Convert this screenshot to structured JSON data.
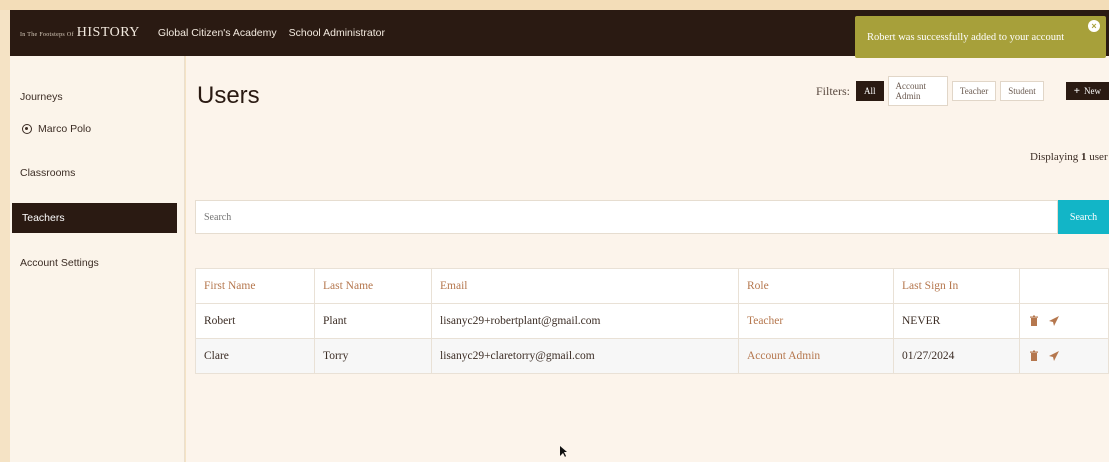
{
  "navbar": {
    "logo_small": "In The Footsteps Of",
    "logo_big": "HISTORY",
    "links": [
      "Global Citizen's Academy",
      "School Administrator"
    ]
  },
  "sidebar": {
    "journeys": "Journeys",
    "journey_sub": "Marco Polo",
    "classrooms": "Classrooms",
    "teachers": "Teachers",
    "account_settings": "Account Settings"
  },
  "page": {
    "title": "Users",
    "filters_label": "Filters:",
    "filters": [
      "All",
      "Account Admin",
      "Teacher",
      "Student"
    ],
    "new_label": "New",
    "displaying_prefix": "Displaying",
    "displaying_count": "1",
    "displaying_suffix": "user"
  },
  "search": {
    "placeholder": "Search",
    "button_label": "Search"
  },
  "table": {
    "headers": [
      "First Name",
      "Last Name",
      "Email",
      "Role",
      "Last Sign In"
    ],
    "rows": [
      {
        "first": "Robert",
        "last": "Plant",
        "email": "lisanyc29+robertplant@gmail.com",
        "role": "Teacher",
        "last_sign_in": "NEVER"
      },
      {
        "first": "Clare",
        "last": "Torry",
        "email": "lisanyc29+claretorry@gmail.com",
        "role": "Account Admin",
        "last_sign_in": "01/27/2024"
      }
    ]
  },
  "toast": {
    "message": "Robert was successfully added to your account",
    "close": "×"
  },
  "colors": {
    "navbar_bg": "#2a1a12",
    "accent_brown": "#b5774e",
    "search_button": "#12b5c7",
    "toast_bg": "#a7a03a"
  },
  "icons": [
    "compass-icon",
    "plus-icon",
    "trash-icon",
    "send-icon",
    "close-icon",
    "cursor-icon"
  ]
}
